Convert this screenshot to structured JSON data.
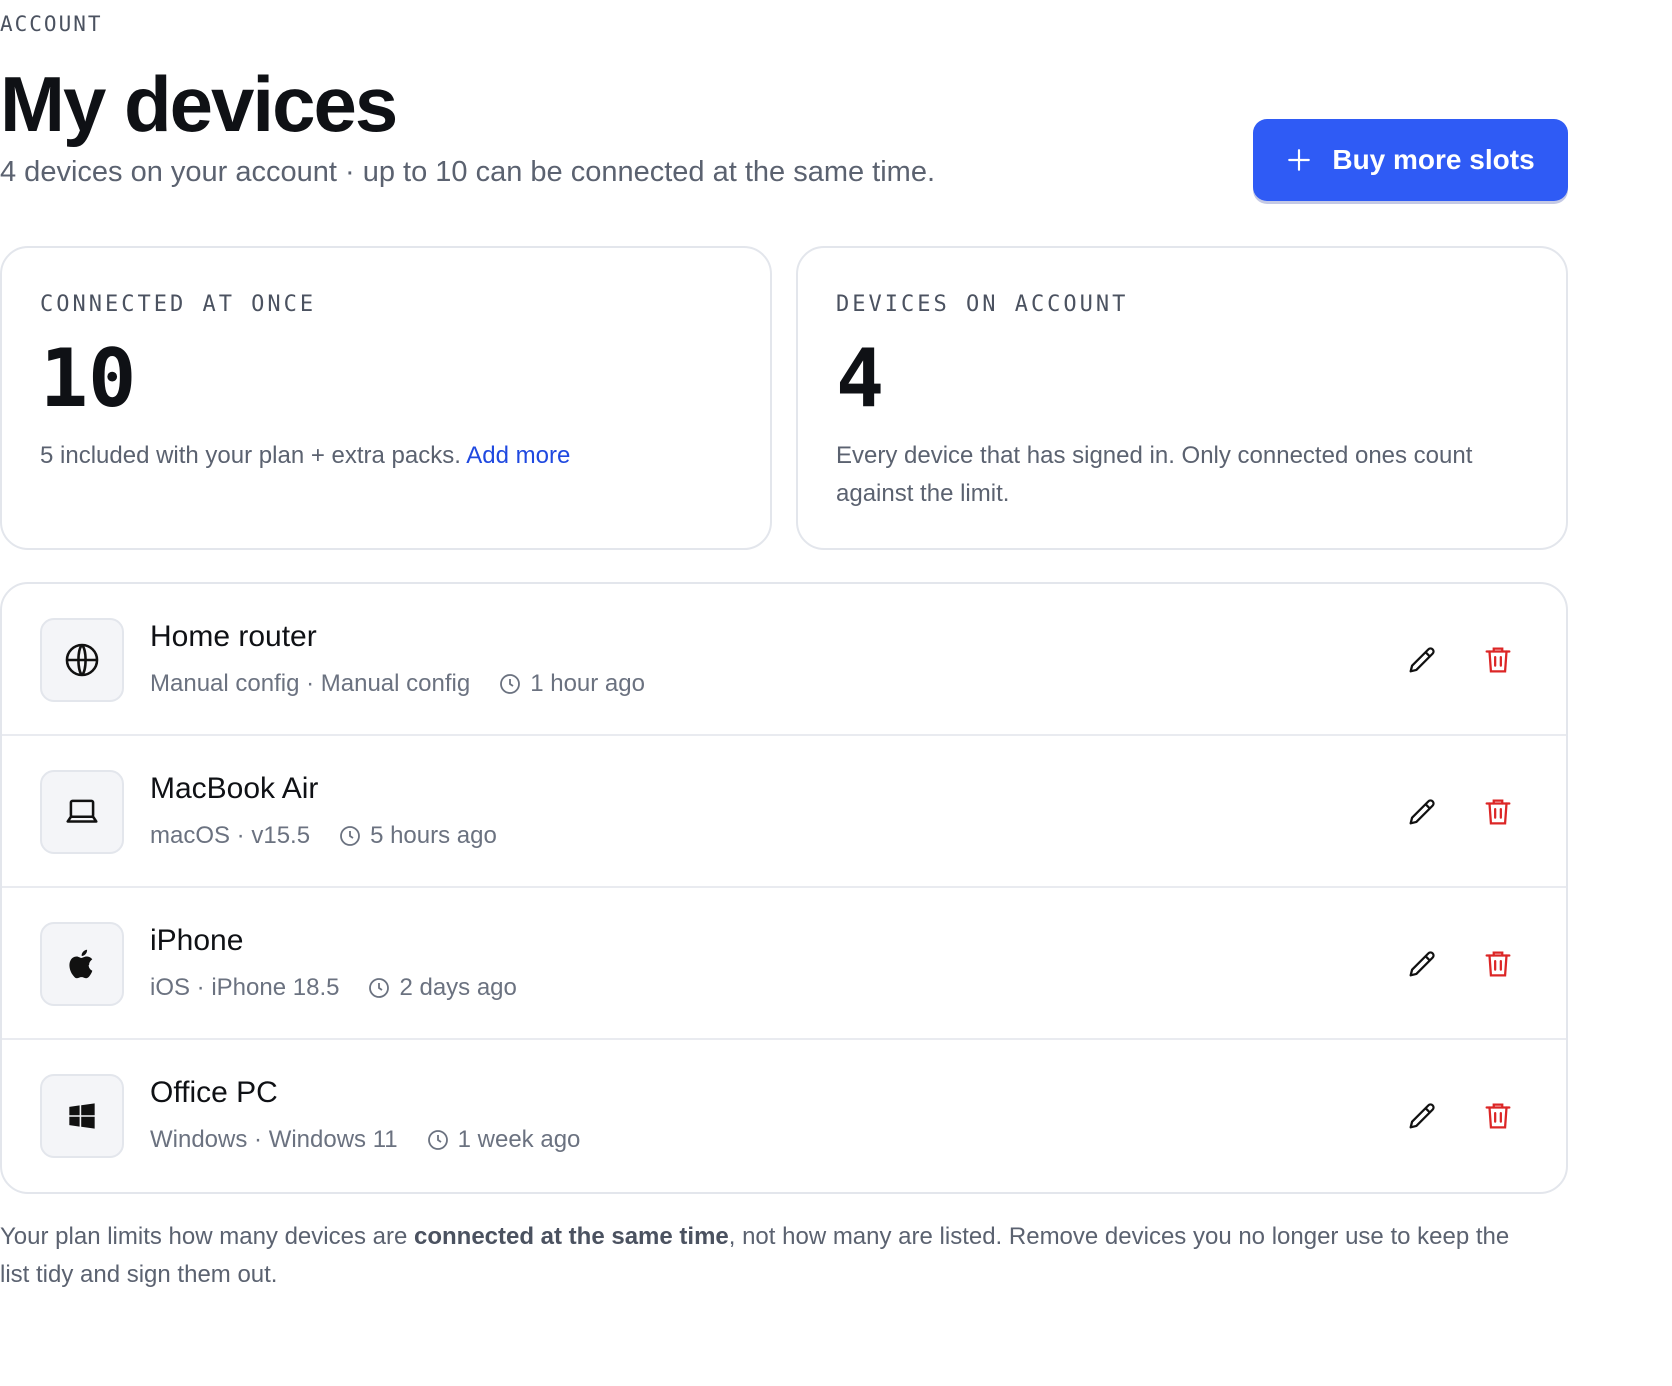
{
  "header": {
    "eyebrow": "ACCOUNT",
    "title": "My devices",
    "subtitle": "4 devices on your account · up to 10 can be connected at the same time.",
    "buy_button": {
      "label": "Buy more slots",
      "icon": "plus-icon",
      "color": "#2f5bf5"
    }
  },
  "stats": {
    "connected": {
      "label": "CONNECTED AT ONCE",
      "value": "10",
      "desc": "5 included with your plan + extra packs.",
      "link": "Add more"
    },
    "devices": {
      "label": "DEVICES ON ACCOUNT",
      "value": "4",
      "desc": "Every device that has signed in. Only connected ones count against the limit."
    }
  },
  "devices": [
    {
      "name": "Home router",
      "platform": "Manual config",
      "version": "Manual config",
      "last_seen": "1 hour ago",
      "icon": "globe-icon"
    },
    {
      "name": "MacBook Air",
      "platform": "macOS",
      "version": "v15.5",
      "last_seen": "5 hours ago",
      "icon": "laptop-icon"
    },
    {
      "name": "iPhone",
      "platform": "iOS",
      "version": "iPhone 18.5",
      "last_seen": "2 days ago",
      "icon": "apple-icon"
    },
    {
      "name": "Office PC",
      "platform": "Windows",
      "version": "Windows 11",
      "last_seen": "1 week ago",
      "icon": "windows-icon"
    }
  ],
  "footer": {
    "before": "Your plan limits how many devices are ",
    "bold": "connected at the same time",
    "after": ", not how many are listed. Remove devices you no longer use to keep the list tidy and sign them out."
  },
  "colors": {
    "accent": "#2f5bf5",
    "link": "#1f49e0",
    "danger": "#dc2626"
  }
}
